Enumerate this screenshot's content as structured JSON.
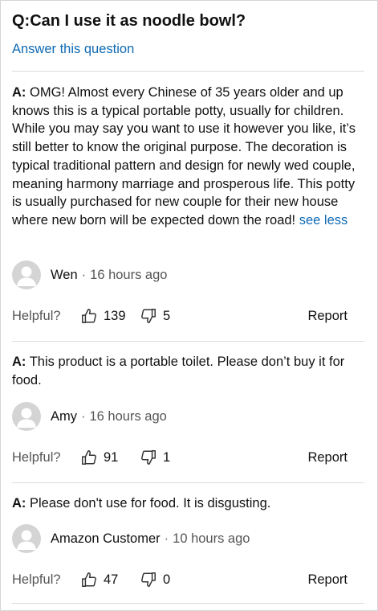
{
  "question": {
    "text": "Q:Can I use it as noodle bowl?"
  },
  "answer_link": "Answer this question",
  "helpful_label": "Helpful?",
  "report_label": "Report",
  "answers": [
    {
      "prefix": "A:",
      "text": " OMG! Almost every Chinese of 35 years older and up knows this is a typical portable potty, usually for children. While you may say you want to use it however you like, it’s still better to know the original purpose. The decoration is typical traditional pattern and design for newly wed couple, meaning harmony marriage and prosperous life. This potty is usually purchased for new couple for their new house where new born will be expected down the road! ",
      "see_less": "see less",
      "author": "Wen",
      "separator": "·",
      "time": "16 hours ago",
      "upvotes": "139",
      "downvotes": "5"
    },
    {
      "prefix": "A:",
      "text": " This product is a portable toilet. Please don’t buy it for food.",
      "author": "Amy",
      "separator": "·",
      "time": "16 hours ago",
      "upvotes": "91",
      "downvotes": "1"
    },
    {
      "prefix": "A:",
      "text": " Please don't use for food. It is disgusting.",
      "author": "Amazon Customer",
      "separator": "·",
      "time": "10 hours ago",
      "upvotes": "47",
      "downvotes": "0"
    }
  ],
  "icons": {
    "avatar": "user-avatar-icon",
    "up": "thumbs-up-icon",
    "down": "thumbs-down-icon"
  },
  "colors": {
    "link": "#0f6ab4",
    "text": "#111111",
    "muted": "#555555",
    "avatar": "#d4d4d4"
  }
}
